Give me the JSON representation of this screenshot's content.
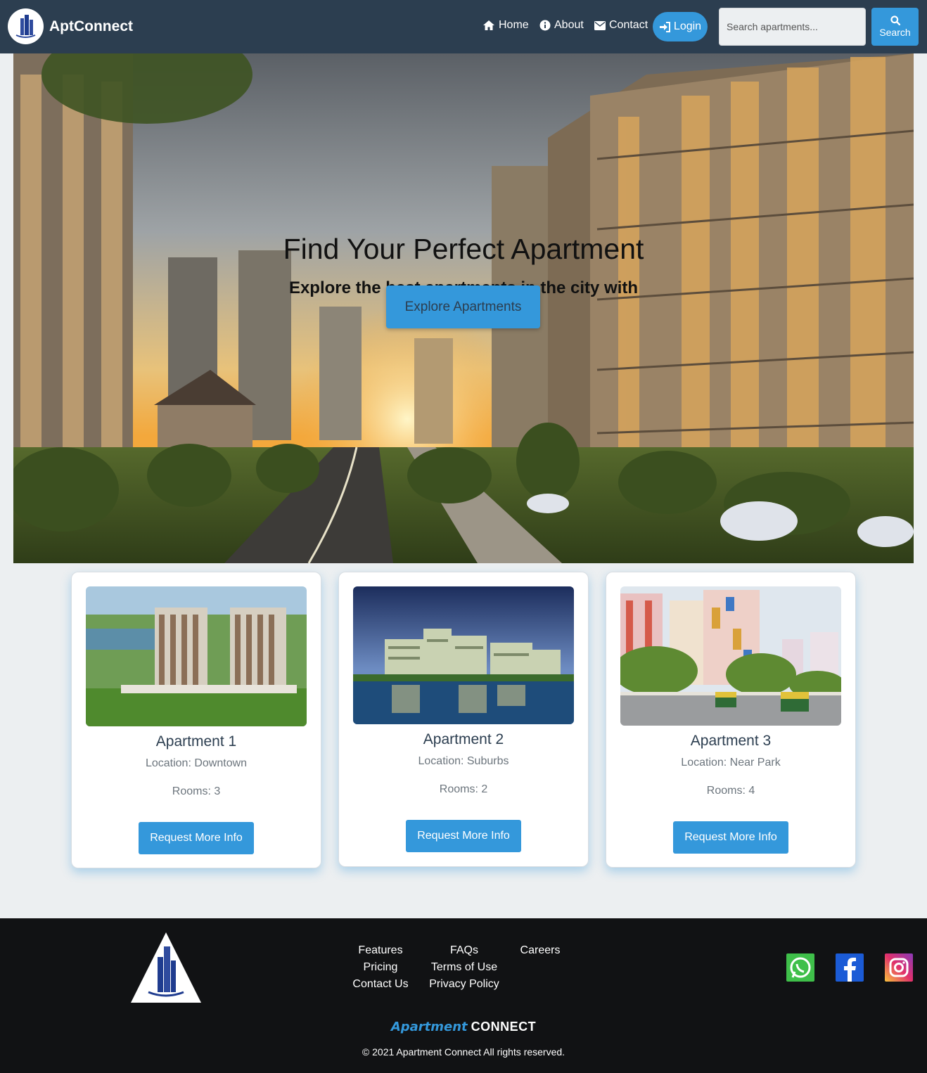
{
  "nav": {
    "brand": "AptConnect",
    "links": [
      {
        "label": "Home",
        "icon": "home-icon"
      },
      {
        "label": "About",
        "icon": "info-icon"
      },
      {
        "label": "Contact",
        "icon": "envelope-icon"
      }
    ],
    "login_label": "Login",
    "search_placeholder": "Search apartments...",
    "search_label": "Search"
  },
  "hero": {
    "title": "Find Your Perfect Apartment",
    "subtitle": "Explore the best apartments in the city with ApartmentConnect",
    "button": "Explore Apartments"
  },
  "cards": [
    {
      "title": "Apartment 1",
      "location": "Location: Downtown",
      "rooms": "Rooms: 3",
      "button": "Request More Info"
    },
    {
      "title": "Apartment 2",
      "location": "Location: Suburbs",
      "rooms": "Rooms: 2",
      "button": "Request More Info"
    },
    {
      "title": "Apartment 3",
      "location": "Location: Near Park",
      "rooms": "Rooms: 4",
      "button": "Request More Info"
    }
  ],
  "footer": {
    "links": [
      "Features",
      "FAQs",
      "Careers",
      "Pricing",
      "Terms of Use",
      "Contact Us",
      "Privacy Policy"
    ],
    "brand_accent": "Apartment",
    "brand_main": "CONNECT",
    "copyright": "© 2021 Apartment Connect All rights reserved.",
    "social": [
      "whatsapp-icon",
      "facebook-icon",
      "instagram-icon"
    ]
  },
  "colors": {
    "navbar": "#2c3e50",
    "accent": "#3498db",
    "footer": "#111214",
    "page_bg": "#eceff1"
  }
}
